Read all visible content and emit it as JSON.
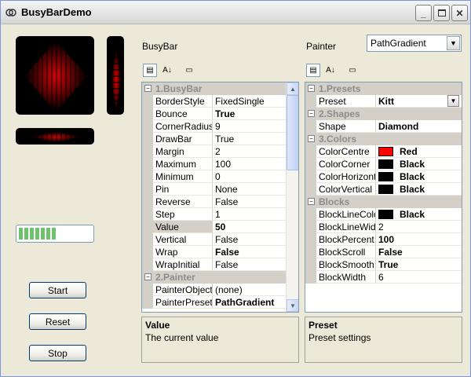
{
  "window": {
    "title": "BusyBarDemo"
  },
  "labels": {
    "busybar": "BusyBar",
    "painter": "Painter"
  },
  "painter_select": {
    "value": "PathGradient"
  },
  "left_grid": {
    "rows": [
      {
        "kind": "cat",
        "label": "1.BusyBar"
      },
      {
        "kind": "prop",
        "name": "BorderStyle",
        "value": "FixedSingle",
        "bold": false
      },
      {
        "kind": "prop",
        "name": "Bounce",
        "value": "True",
        "bold": true
      },
      {
        "kind": "prop",
        "name": "CornerRadius",
        "value": "9",
        "bold": false
      },
      {
        "kind": "prop",
        "name": "DrawBar",
        "value": "True",
        "bold": false
      },
      {
        "kind": "prop",
        "name": "Margin",
        "value": "2",
        "bold": false
      },
      {
        "kind": "prop",
        "name": "Maximum",
        "value": "100",
        "bold": false
      },
      {
        "kind": "prop",
        "name": "Minimum",
        "value": "0",
        "bold": false
      },
      {
        "kind": "prop",
        "name": "Pin",
        "value": "None",
        "bold": false
      },
      {
        "kind": "prop",
        "name": "Reverse",
        "value": "False",
        "bold": false
      },
      {
        "kind": "prop",
        "name": "Step",
        "value": "1",
        "bold": false
      },
      {
        "kind": "prop",
        "name": "Value",
        "value": "50",
        "bold": true,
        "selected": true
      },
      {
        "kind": "prop",
        "name": "Vertical",
        "value": "False",
        "bold": false
      },
      {
        "kind": "prop",
        "name": "Wrap",
        "value": "False",
        "bold": true
      },
      {
        "kind": "prop",
        "name": "WrapInitial",
        "value": "False",
        "bold": false
      },
      {
        "kind": "cat",
        "label": "2.Painter"
      },
      {
        "kind": "prop",
        "name": "PainterObject",
        "value": "(none)",
        "bold": false
      },
      {
        "kind": "prop",
        "name": "PainterPreset",
        "value": "PathGradient",
        "bold": true
      }
    ],
    "desc_title": "Value",
    "desc_text": "The current value"
  },
  "right_grid": {
    "rows": [
      {
        "kind": "cat",
        "label": "1.Presets"
      },
      {
        "kind": "prop",
        "name": "Preset",
        "value": "Kitt",
        "bold": true,
        "dropdown": true
      },
      {
        "kind": "cat",
        "label": "2.Shapes"
      },
      {
        "kind": "prop",
        "name": "Shape",
        "value": "Diamond",
        "bold": true
      },
      {
        "kind": "cat",
        "label": "3.Colors"
      },
      {
        "kind": "prop",
        "name": "ColorCentre",
        "value": "Red",
        "bold": true,
        "color": "#ff0000"
      },
      {
        "kind": "prop",
        "name": "ColorCorner",
        "value": "Black",
        "bold": true,
        "color": "#000000"
      },
      {
        "kind": "prop",
        "name": "ColorHorizontal",
        "value": "Black",
        "bold": true,
        "color": "#000000"
      },
      {
        "kind": "prop",
        "name": "ColorVertical",
        "value": "Black",
        "bold": true,
        "color": "#000000"
      },
      {
        "kind": "cat",
        "label": "Blocks"
      },
      {
        "kind": "prop",
        "name": "BlockLineColor",
        "value": "Black",
        "bold": true,
        "color": "#000000"
      },
      {
        "kind": "prop",
        "name": "BlockLineWidth",
        "value": "2",
        "bold": false
      },
      {
        "kind": "prop",
        "name": "BlockPercent",
        "value": "100",
        "bold": true
      },
      {
        "kind": "prop",
        "name": "BlockScroll",
        "value": "False",
        "bold": true
      },
      {
        "kind": "prop",
        "name": "BlockSmooth",
        "value": "True",
        "bold": true
      },
      {
        "kind": "prop",
        "name": "BlockWidth",
        "value": "6",
        "bold": false
      }
    ],
    "desc_title": "Preset",
    "desc_text": "Preset settings"
  },
  "buttons": {
    "start": "Start",
    "reset": "Reset",
    "stop": "Stop"
  },
  "colors": {
    "bar_red": "#d40000",
    "progress_green": "#6cc36c"
  }
}
